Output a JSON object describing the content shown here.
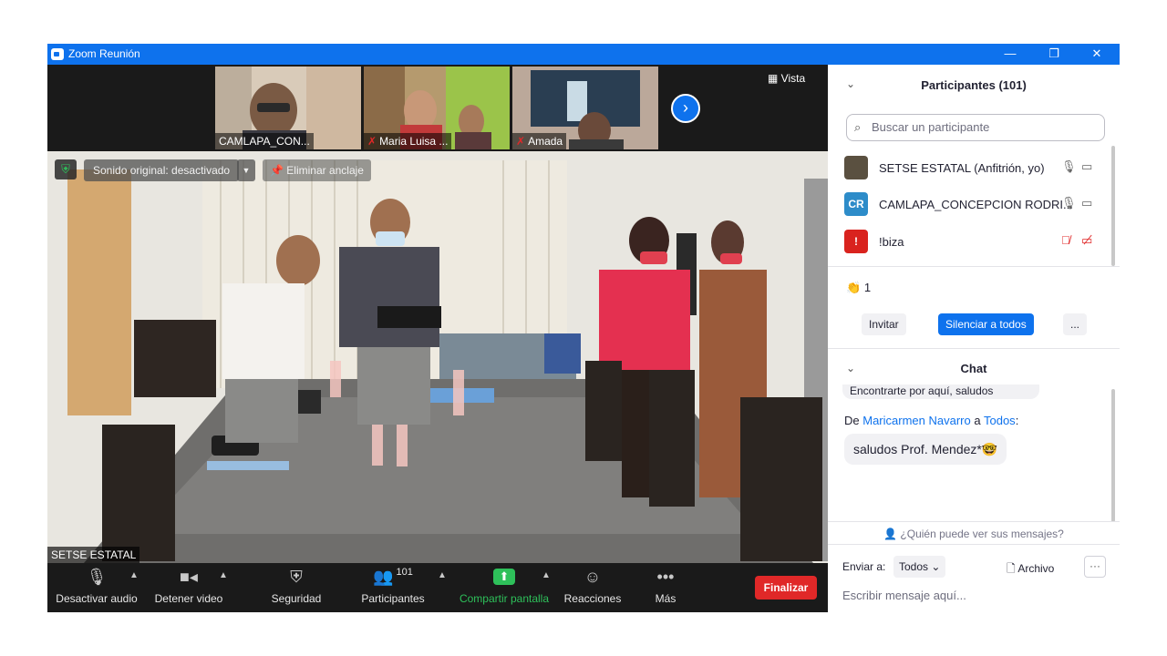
{
  "window": {
    "title": "Zoom Reunión",
    "minimize": "—",
    "restore": "❐",
    "close": "✕"
  },
  "thumbnails": [
    {
      "name": "CAMLAPA_CON...",
      "muted": false
    },
    {
      "name": "Maria Luisa ...",
      "muted": true
    },
    {
      "name": "Amada",
      "muted": true
    }
  ],
  "next_label": "›",
  "view_label": "Vista",
  "main_video": {
    "sound_label": "Sonido original: desactivado",
    "unpin_label": "Eliminar anclaje",
    "speaker_name": "SETSE ESTATAL"
  },
  "toolbar": {
    "mute_label": "Desactivar audio",
    "video_label": "Detener video",
    "security_label": "Seguridad",
    "participants_label": "Participantes",
    "participants_count": "101",
    "share_label": "Compartir pantalla",
    "reactions_label": "Reacciones",
    "more_label": "Más",
    "end_label": "Finalizar"
  },
  "participants_panel": {
    "title": "Participantes (101)",
    "search_placeholder": "Buscar un participante",
    "items": [
      {
        "avatar_text": "",
        "avatar_color": "#5a5040",
        "name": "SETSE ESTATAL (Anfitrión, yo)",
        "muted": false
      },
      {
        "avatar_text": "CR",
        "avatar_color": "#2d8cc9",
        "name": "CAMLAPA_CONCEPCION RODRI...",
        "muted": false
      },
      {
        "avatar_text": "!",
        "avatar_color": "#d9231e",
        "name": "!biza",
        "muted": true
      }
    ],
    "reaction_count": "1",
    "invite_label": "Invitar",
    "mute_all_label": "Silenciar a todos",
    "more_label": "..."
  },
  "chat": {
    "title": "Chat",
    "cut_message": "Encontrarte por aquí, saludos",
    "from_prefix": "De",
    "from_sender": "Maricarmen Navarro",
    "from_to_word": "a",
    "from_recipient": "Todos",
    "from_suffix": ":",
    "message": "saludos Prof. Mendez*🤓",
    "who_can_see": "¿Quién puede ver sus mensajes?",
    "send_to_label": "Enviar a:",
    "send_to_value": "Todos",
    "file_label": "Archivo",
    "more_label": "···",
    "input_placeholder": "Escribir mensaje aquí..."
  },
  "colors": {
    "brand": "#0e72ed",
    "danger": "#e02828",
    "share_green": "#2ec05a"
  }
}
